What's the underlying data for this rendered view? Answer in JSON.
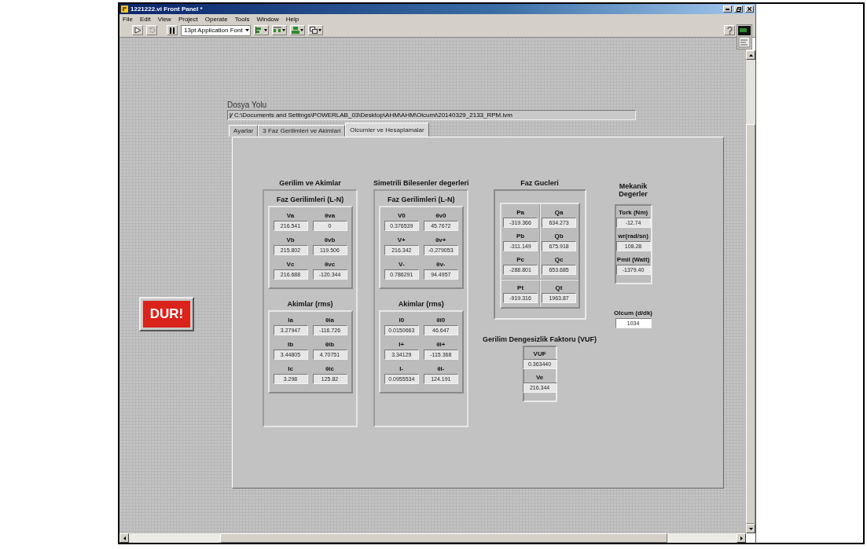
{
  "window": {
    "title": "1221222.vi Front Panel *"
  },
  "menu": [
    "File",
    "Edit",
    "View",
    "Project",
    "Operate",
    "Tools",
    "Window",
    "Help"
  ],
  "toolbar": {
    "font": "13pt Application Font"
  },
  "stop_button": {
    "label": "DUR!"
  },
  "path_control": {
    "label": "Dosya Yolu",
    "value": "C:\\Documents and Settings\\POWERLAB_03\\Desktop\\AHM\\AHM\\Olcumi\\20140329_2133_RPM.lvm"
  },
  "tabs": [
    {
      "label": "Ayarlar",
      "selected": false
    },
    {
      "label": "3 Faz Gerilimleri ve Akimlari",
      "selected": false
    },
    {
      "label": "Olcumler ve Hesaplamalar",
      "selected": true
    }
  ],
  "columns": [
    {
      "panels": [
        {
          "kind": "clusters",
          "title": "Gerilim ve Akimlar",
          "sections": [
            {
              "title": "Faz Gerilimleri (L-N)",
              "fields": [
                {
                  "label": "Va",
                  "value": "216.541"
                },
                {
                  "label": "θva",
                  "value": "0"
                },
                {
                  "label": "Vb",
                  "value": "215.802"
                },
                {
                  "label": "θvb",
                  "value": "119.506"
                },
                {
                  "label": "Vc",
                  "value": "216.688"
                },
                {
                  "label": "θvc",
                  "value": "-120.344"
                }
              ]
            },
            {
              "title": "Akimlar (rms)",
              "fields": [
                {
                  "label": "Ia",
                  "value": "3.27947"
                },
                {
                  "label": "θia",
                  "value": "-116.726"
                },
                {
                  "label": "Ib",
                  "value": "3.44805"
                },
                {
                  "label": "θib",
                  "value": "4.70751"
                },
                {
                  "label": "Ic",
                  "value": "3.298"
                },
                {
                  "label": "θic",
                  "value": "125.82"
                }
              ]
            }
          ]
        }
      ]
    },
    {
      "panels": [
        {
          "kind": "clusters",
          "title": "Simetrili Bilesenler degerleri",
          "sections": [
            {
              "title": "Faz Gerilimleri (L-N)",
              "fields": [
                {
                  "label": "V0",
                  "value": "0.376539"
                },
                {
                  "label": "θv0",
                  "value": "45.7672"
                },
                {
                  "label": "V+",
                  "value": "216.342"
                },
                {
                  "label": "θv+",
                  "value": "-0.279053"
                },
                {
                  "label": "V-",
                  "value": "0.786291"
                },
                {
                  "label": "θv-",
                  "value": "94.4957"
                }
              ]
            },
            {
              "title": "Akimlar (rms)",
              "fields": [
                {
                  "label": "I0",
                  "value": "0.0150663"
                },
                {
                  "label": "θi0",
                  "value": "46.647"
                },
                {
                  "label": "I+",
                  "value": "3.34129"
                },
                {
                  "label": "θi+",
                  "value": "-115.368"
                },
                {
                  "label": "I-",
                  "value": "0.0955534"
                },
                {
                  "label": "θi-",
                  "value": "124.191"
                }
              ]
            }
          ]
        }
      ]
    },
    {
      "panels": [
        {
          "kind": "blocks",
          "title": "Faz Gucleri",
          "blocks": [
            [
              {
                "label": "Pa",
                "value": "-319.366"
              },
              {
                "label": "Qa",
                "value": "634.273"
              },
              {
                "label": "Pb",
                "value": "-311.149"
              },
              {
                "label": "Qb",
                "value": "675.918"
              },
              {
                "label": "Pc",
                "value": "-288.801"
              },
              {
                "label": "Qc",
                "value": "653.685"
              }
            ],
            [
              {
                "label": "Pt",
                "value": "-919.316"
              },
              {
                "label": "Qt",
                "value": "1963.87"
              }
            ]
          ]
        },
        {
          "kind": "list",
          "title": "Gerilim Dengesizlik Faktoru (VUF)",
          "fields": [
            {
              "label": "VUF",
              "value": "0.363440"
            },
            {
              "label": "Ve",
              "value": "216.344"
            }
          ]
        }
      ]
    },
    {
      "panels": [
        {
          "kind": "list",
          "title": "Mekanik Degerler",
          "fields": [
            {
              "label": "Tork (Nm)",
              "value": "-12.74"
            },
            {
              "label": "wr(rad/sn)",
              "value": "108.28"
            },
            {
              "label": "Pmil (Watt)",
              "value": "-1379.40"
            }
          ]
        },
        {
          "kind": "control",
          "label": "Olcum (d/dk)",
          "value": "1034"
        }
      ]
    }
  ]
}
